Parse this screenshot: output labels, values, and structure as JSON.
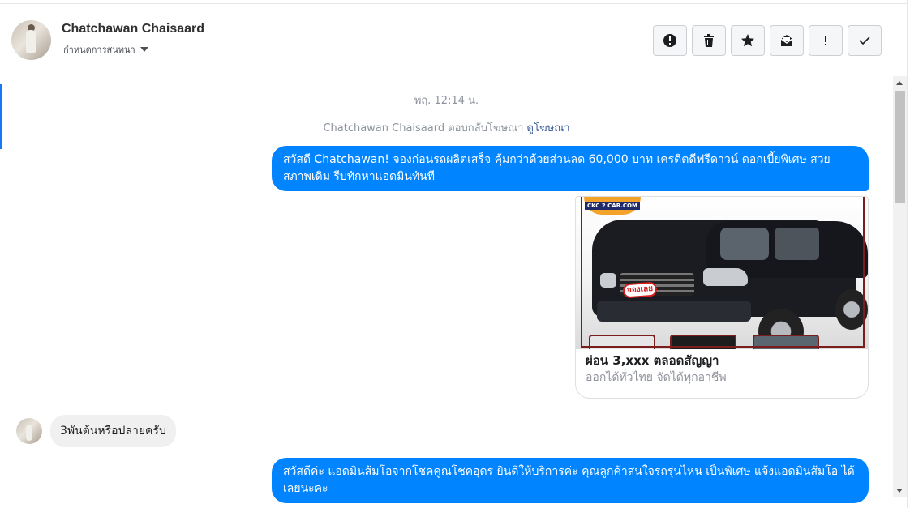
{
  "header": {
    "name": "Chatchawan Chaisaard",
    "assign_label": "กำหนดการสนทนา",
    "toolbar": [
      {
        "name": "spam-button",
        "icon": "alert-circle-icon"
      },
      {
        "name": "delete-button",
        "icon": "trash-icon"
      },
      {
        "name": "star-button",
        "icon": "star-icon"
      },
      {
        "name": "mark-unread-button",
        "icon": "envelope-icon"
      },
      {
        "name": "important-button",
        "icon": "exclamation-icon"
      },
      {
        "name": "done-button",
        "icon": "check-icon"
      }
    ]
  },
  "thread": {
    "timestamp": "พฤ. 12:14 น.",
    "reply_info": "Chatchawan Chaisaard ตอบกลับโฆษณา",
    "view_ad_link": "ดูโฆษณา",
    "messages": [
      {
        "text": "สวัสดี Chatchawan! จองก่อนรถผลิตเสร็จ คุ้มกว่าด้วยส่วนลด 60,000 บาท เครดิตดีฟรีดาวน์ ดอกเบี้ยพิเศษ สวยสภาพเดิม รีบทักหาแอดมินทันที"
      },
      {
        "card_title": "ผ่อน 3,xxx ตลอดสัญญา",
        "card_subtitle": "ออกได้ทั่วไทย จัดได้ทุกอาชีพ",
        "card_logo": "CKC 2 CAR.COM",
        "card_badge": "จองเลย"
      },
      {
        "text": "3พันต้นหรือปลายครับ"
      },
      {
        "text": "สวัสดีค่ะ แอดมินส้มโอจากโชคคูณโชคอุดร ยินดีให้บริการค่ะ   คุณลูกค้าสนใจรถรุ่นไหน เป็นพิเศษ แจ้งแอดมินส้มโอ ได้เลยนะคะ"
      }
    ]
  },
  "colors": {
    "outgoing_bubble": "#0084ff",
    "incoming_bubble": "#f1f0f0",
    "link": "#385898"
  }
}
